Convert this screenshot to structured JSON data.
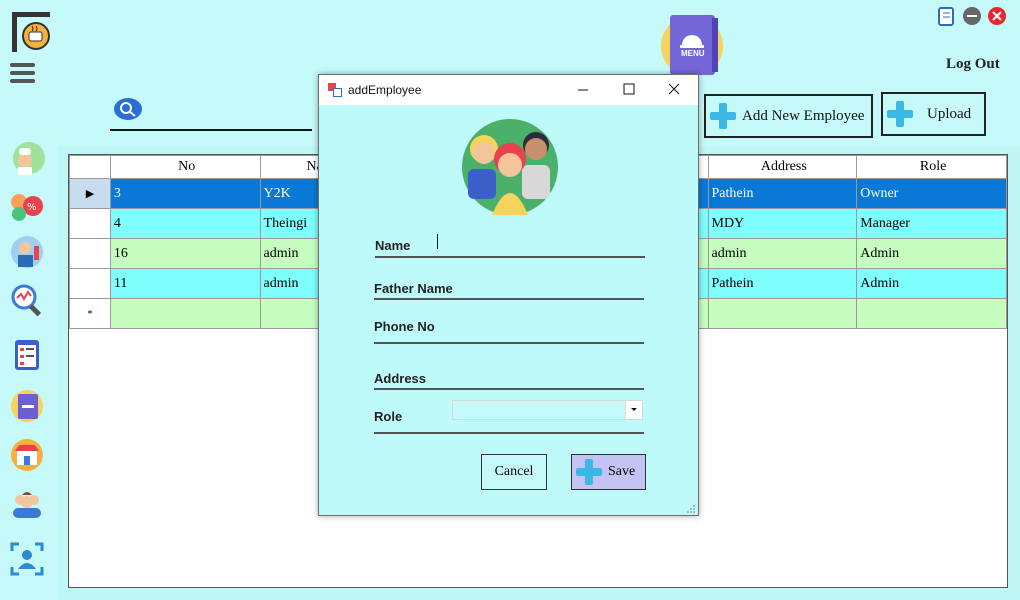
{
  "header": {
    "logout_label": "Log Out",
    "menu_book_label": "MENU"
  },
  "toolbar": {
    "add_employee_label": "Add New Employee",
    "upload_label": "Upload",
    "search_value": ""
  },
  "grid": {
    "columns": [
      "No",
      "Na",
      "Address",
      "Role"
    ],
    "rows": [
      {
        "no": "3",
        "name": "Y2K",
        "address": "Pathein",
        "role": "Owner"
      },
      {
        "no": "4",
        "name": "Theingi",
        "address": "MDY",
        "role": "Manager"
      },
      {
        "no": "16",
        "name": "admin",
        "address": "admin",
        "role": "Admin"
      },
      {
        "no": "11",
        "name": "admin",
        "address": "Pathein",
        "role": "Admin"
      }
    ],
    "new_row_marker": "*",
    "selected_marker": "▶"
  },
  "dialog": {
    "title": "addEmployee",
    "fields": {
      "name_label": "Name",
      "father_label": "Father Name",
      "phone_label": "Phone No",
      "address_label": "Address",
      "role_label": "Role"
    },
    "cancel_label": "Cancel",
    "save_label": "Save"
  },
  "colors": {
    "background": "#c6fafa",
    "selected_row": "#0a78d7",
    "row_cyan": "#7ffefe",
    "row_green": "#c6fec0",
    "save_button": "#c4c4f4",
    "accent_plus": "#3cb8e6"
  }
}
